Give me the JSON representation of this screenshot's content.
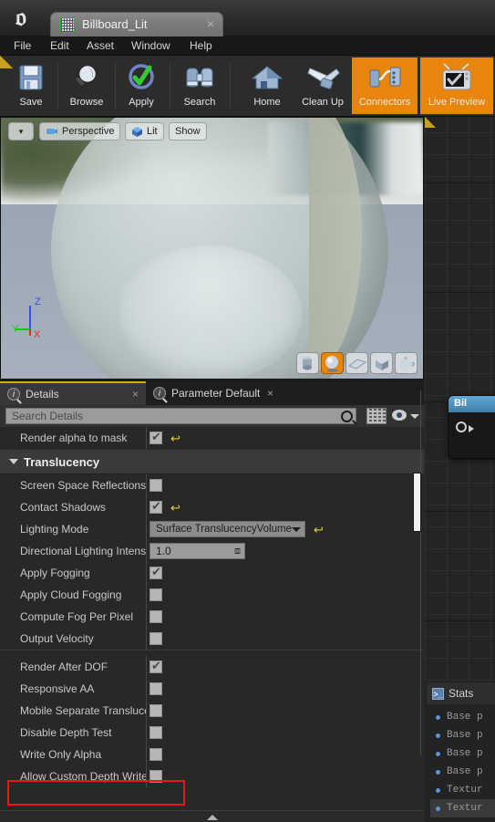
{
  "app": {
    "logo": "unreal-engine-logo"
  },
  "titlebar": {
    "tab": {
      "label": "Billboard_Lit",
      "icon": "material-asset-icon",
      "close": "×"
    }
  },
  "menubar": {
    "items": [
      {
        "label": "File"
      },
      {
        "label": "Edit"
      },
      {
        "label": "Asset"
      },
      {
        "label": "Window"
      },
      {
        "label": "Help"
      }
    ]
  },
  "toolbar": {
    "buttons": [
      {
        "label": "Save",
        "icon": "floppy-disk-icon",
        "active": false
      },
      {
        "label": "Browse",
        "icon": "magnifier-icon",
        "active": false
      },
      {
        "label": "Apply",
        "icon": "green-check-icon",
        "active": false
      },
      {
        "label": "Search",
        "icon": "binoculars-icon",
        "active": false
      },
      {
        "label": "Home",
        "icon": "house-icon",
        "active": false
      },
      {
        "label": "Clean Up",
        "icon": "broom-icon",
        "active": false
      },
      {
        "label": "Connectors",
        "icon": "connectors-icon",
        "active": true
      },
      {
        "label": "Live Preview",
        "icon": "tv-check-icon",
        "active": true
      }
    ],
    "accent_color": "#e8850c"
  },
  "viewport": {
    "menu_caret": "▾",
    "buttons": [
      {
        "label": "Perspective",
        "icon": "camera-perspective-icon"
      },
      {
        "label": "Lit",
        "icon": "lit-cube-icon"
      },
      {
        "label": "Show",
        "icon": ""
      }
    ],
    "gizmo": {
      "x": "X",
      "y": "Y",
      "z": "Z",
      "x_color": "#ff2020",
      "y_color": "#18c818",
      "z_color": "#3a4ef0"
    },
    "shapes": [
      {
        "name": "cylinder-preview-shape",
        "selected": false
      },
      {
        "name": "sphere-preview-shape",
        "selected": true
      },
      {
        "name": "plane-preview-shape",
        "selected": false
      },
      {
        "name": "cube-preview-shape",
        "selected": false
      },
      {
        "name": "teapot-preview-shape",
        "selected": false
      }
    ]
  },
  "graph": {
    "node_title": "Bil"
  },
  "stats": {
    "tab_label": "Stats",
    "tab_icon": "stats-console-icon",
    "rows": [
      {
        "text": "Base p",
        "highlighted": false
      },
      {
        "text": "Base p",
        "highlighted": false
      },
      {
        "text": "Base p",
        "highlighted": false
      },
      {
        "text": "Base p",
        "highlighted": false
      },
      {
        "text": "Textur",
        "highlighted": false
      },
      {
        "text": "Textur",
        "highlighted": true
      }
    ]
  },
  "details": {
    "tabs": [
      {
        "label": "Details",
        "active": true,
        "close": "×"
      },
      {
        "label": "Parameter Defaults",
        "active": false,
        "close": "×"
      }
    ],
    "search": {
      "placeholder": "Search Details",
      "value": ""
    },
    "rows": [
      {
        "kind": "checkbox",
        "label": "Render alpha to mask",
        "checked": true,
        "reset": true
      },
      {
        "kind": "category",
        "label": "Translucency"
      },
      {
        "kind": "checkbox",
        "label": "Screen Space Reflections",
        "checked": false,
        "reset": false
      },
      {
        "kind": "checkbox",
        "label": "Contact Shadows",
        "checked": true,
        "reset": true
      },
      {
        "kind": "combo",
        "label": "Lighting Mode",
        "value": "Surface TranslucencyVolume",
        "reset": true
      },
      {
        "kind": "number",
        "label": "Directional Lighting Intensit",
        "value": "1.0"
      },
      {
        "kind": "checkbox",
        "label": "Apply Fogging",
        "checked": true,
        "reset": false
      },
      {
        "kind": "checkbox",
        "label": "Apply Cloud Fogging",
        "checked": false,
        "reset": false
      },
      {
        "kind": "checkbox",
        "label": "Compute Fog Per Pixel",
        "checked": false,
        "reset": false
      },
      {
        "kind": "checkbox",
        "label": "Output Velocity",
        "checked": false,
        "reset": false
      },
      {
        "kind": "separator"
      },
      {
        "kind": "checkbox",
        "label": "Render After DOF",
        "checked": true,
        "reset": false
      },
      {
        "kind": "checkbox",
        "label": "Responsive AA",
        "checked": false,
        "reset": false
      },
      {
        "kind": "checkbox",
        "label": "Mobile Separate Translucency",
        "checked": false,
        "reset": false
      },
      {
        "kind": "checkbox",
        "label": "Disable Depth Test",
        "checked": false,
        "reset": false
      },
      {
        "kind": "checkbox",
        "label": "Write Only Alpha",
        "checked": false,
        "reset": false
      },
      {
        "kind": "checkbox",
        "label": "Allow Custom Depth Writes",
        "checked": false,
        "reset": false,
        "highlighted": true
      }
    ],
    "highlight_color": "#f01414"
  }
}
